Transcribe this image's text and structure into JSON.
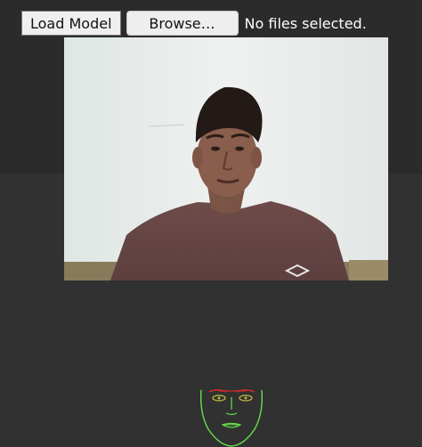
{
  "controls": {
    "load_model_label": "Load Model",
    "browse_label": "Browse…",
    "file_status": "No files selected."
  },
  "icons": {
    "video": "webcam-video-frame",
    "landmarks": "face-landmark-overlay"
  },
  "colors": {
    "background": "#313131",
    "landmark_outline": "#66e04a",
    "landmark_brows": "#d62b2b",
    "landmark_eyes": "#c9c23a"
  }
}
